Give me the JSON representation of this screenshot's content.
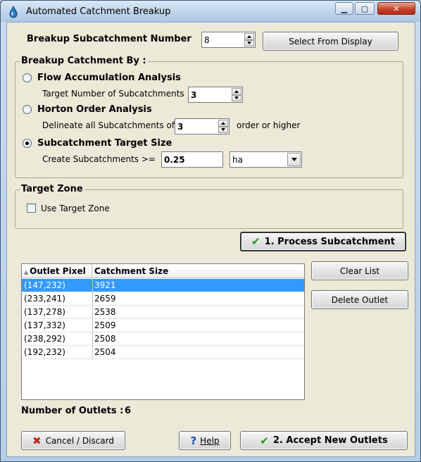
{
  "window": {
    "title": "Automated Catchment Breakup",
    "minimize_glyph": "▁",
    "maximize_glyph": "▢",
    "close_glyph": "✕"
  },
  "breakup": {
    "label": "Breakup Subcatchment Number",
    "value": "8",
    "select_button": "Select From Display"
  },
  "method_group": {
    "title": "Breakup Catchment By :",
    "flow": {
      "label": "Flow Accumulation Analysis",
      "checked": false,
      "sub_label": "Target Number of Subcatchments",
      "value": "3"
    },
    "horton": {
      "label": "Horton Order Analysis",
      "checked": false,
      "sub_label": "Delineate all Subcatchments of",
      "value": "3",
      "suffix": "order or higher"
    },
    "target_size": {
      "label": "Subcatchment Target Size",
      "checked": true,
      "sub_label": "Create Subcatchments >=",
      "value": "0.25",
      "unit": "ha"
    }
  },
  "target_zone": {
    "title": "Target Zone",
    "checkbox_label": "Use Target Zone",
    "checked": false
  },
  "process_button": "1. Process Subcatchment",
  "outlets": {
    "columns": [
      "Outlet Pixel",
      "Catchment Size"
    ],
    "rows": [
      {
        "pixel": "(147,232)",
        "size": "3921",
        "selected": true
      },
      {
        "pixel": "(233,241)",
        "size": "2659",
        "selected": false
      },
      {
        "pixel": "(137,278)",
        "size": "2538",
        "selected": false
      },
      {
        "pixel": "(137,332)",
        "size": "2509",
        "selected": false
      },
      {
        "pixel": "(238,292)",
        "size": "2508",
        "selected": false
      },
      {
        "pixel": "(192,232)",
        "size": "2504",
        "selected": false
      }
    ]
  },
  "clear_list_button": "Clear List",
  "delete_outlet_button": "Delete Outlet",
  "count": {
    "label": "Number of Outlets :",
    "value": "6"
  },
  "footer": {
    "cancel_label": "Cancel / Discard",
    "help_label": "Help",
    "accept_label": "2. Accept New Outlets"
  },
  "icons": {
    "app": "water-drop-icon",
    "check": "green-check-icon",
    "cancel": "red-x-icon",
    "help": "question-mark-icon",
    "sort": "sort-arrow-icon"
  },
  "colors": {
    "selection": "#3399ff",
    "dialog_bg": "#ece9d8",
    "check_green": "#1b9a1b",
    "cancel_red": "#c0281e",
    "help_blue": "#1d48b5"
  }
}
